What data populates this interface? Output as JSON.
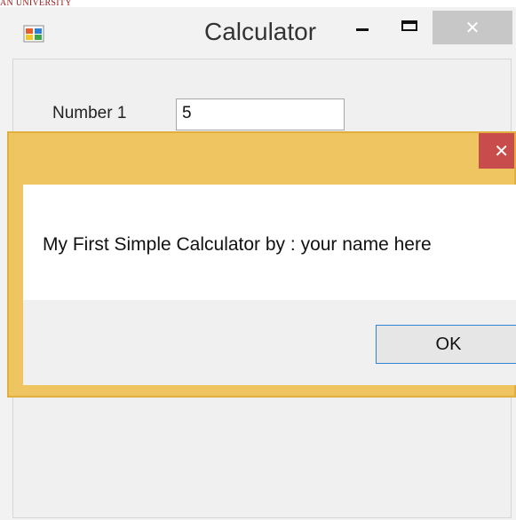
{
  "watermark": "AN UNIVERSITY",
  "calculator": {
    "title": "Calculator",
    "close_glyph": "✕",
    "number1_label": "Number 1",
    "number1_value": "5"
  },
  "message_box": {
    "text": "My First Simple Calculator by : your name here",
    "ok_label": "OK",
    "close_glyph": "✕"
  },
  "colors": {
    "dialog_frame": "#efc562",
    "dialog_close": "#c94c4c",
    "ok_focus_border": "#2f86d4"
  }
}
